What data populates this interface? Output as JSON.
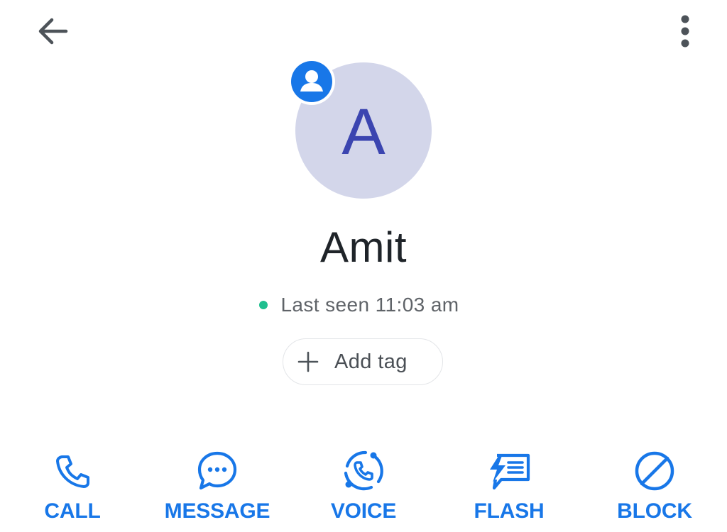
{
  "header": {
    "back_icon": "arrow-left-icon",
    "more_icon": "more-vertical-icon"
  },
  "contact": {
    "avatar_letter": "A",
    "badge_icon": "person-circle-icon",
    "name": "Amit",
    "status_text": "Last seen 11:03 am",
    "status_color": "#1fbf8f"
  },
  "tag": {
    "add_label": "Add tag",
    "add_icon": "plus-icon"
  },
  "actions": [
    {
      "label": "CALL",
      "icon": "phone-icon"
    },
    {
      "label": "MESSAGE",
      "icon": "message-bubble-icon"
    },
    {
      "label": "VOICE",
      "icon": "voice-icon"
    },
    {
      "label": "FLASH",
      "icon": "flash-message-icon"
    },
    {
      "label": "BLOCK",
      "icon": "block-icon"
    }
  ],
  "colors": {
    "accent": "#1877e8",
    "avatar_bg": "#d3d6ea",
    "avatar_letter": "#3b45b0"
  }
}
